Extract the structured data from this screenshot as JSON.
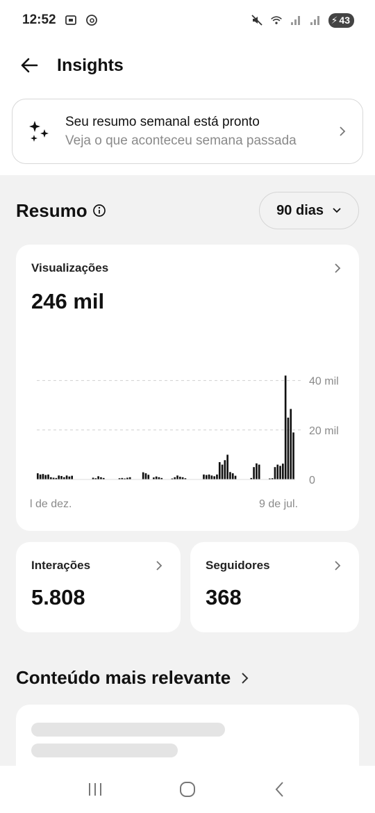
{
  "status_bar": {
    "time": "12:52",
    "left_icons": [
      "screenshot-icon",
      "threads-icon"
    ],
    "right_icons": [
      "mute-icon",
      "wifi-icon",
      "signal-icon",
      "signal-icon-2"
    ],
    "battery": "43"
  },
  "header": {
    "title": "Insights"
  },
  "weekly_summary": {
    "title": "Seu resumo semanal está pronto",
    "subtitle": "Veja o que aconteceu semana passada"
  },
  "summary_section": {
    "title": "Resumo",
    "range_label": "90 dias"
  },
  "views_card": {
    "label": "Visualizações",
    "value": "246 mil"
  },
  "chart_data": {
    "type": "bar",
    "title": "",
    "xlabel": "",
    "ylabel": "",
    "x_tick_labels": [
      "l de dez.",
      "9 de jul."
    ],
    "y_tick_labels": [
      "40 mil",
      "20 mil",
      "0"
    ],
    "ylim": [
      0,
      50000
    ],
    "grid": "horizontal dashed",
    "series": [
      {
        "values": [
          2500,
          2000,
          2200,
          1800,
          2000,
          900,
          700,
          600,
          1600,
          1400,
          900,
          1600,
          1200,
          1500,
          0,
          0,
          0,
          0,
          0,
          0,
          0,
          700,
          500,
          1300,
          900,
          600,
          0,
          0,
          0,
          0,
          0,
          500,
          600,
          400,
          700,
          900,
          0,
          0,
          0,
          0,
          2900,
          2500,
          1900,
          0,
          800,
          1200,
          900,
          600,
          0,
          0,
          0,
          400,
          900,
          1600,
          1100,
          900,
          500,
          0,
          0,
          0,
          0,
          0,
          0,
          2000,
          1800,
          2000,
          1600,
          1300,
          2000,
          7000,
          6000,
          7800,
          10000,
          3000,
          2500,
          1500,
          0,
          0,
          0,
          0,
          0,
          600,
          5000,
          6500,
          6000,
          0,
          0,
          0,
          400,
          500,
          5000,
          6000,
          5500,
          6400,
          42000,
          25000,
          28500,
          19000
        ]
      }
    ]
  },
  "interactions_card": {
    "label": "Interações",
    "value": "5.808"
  },
  "followers_card": {
    "label": "Seguidores",
    "value": "368"
  },
  "relevant_section": {
    "title": "Conteúdo mais relevante"
  }
}
